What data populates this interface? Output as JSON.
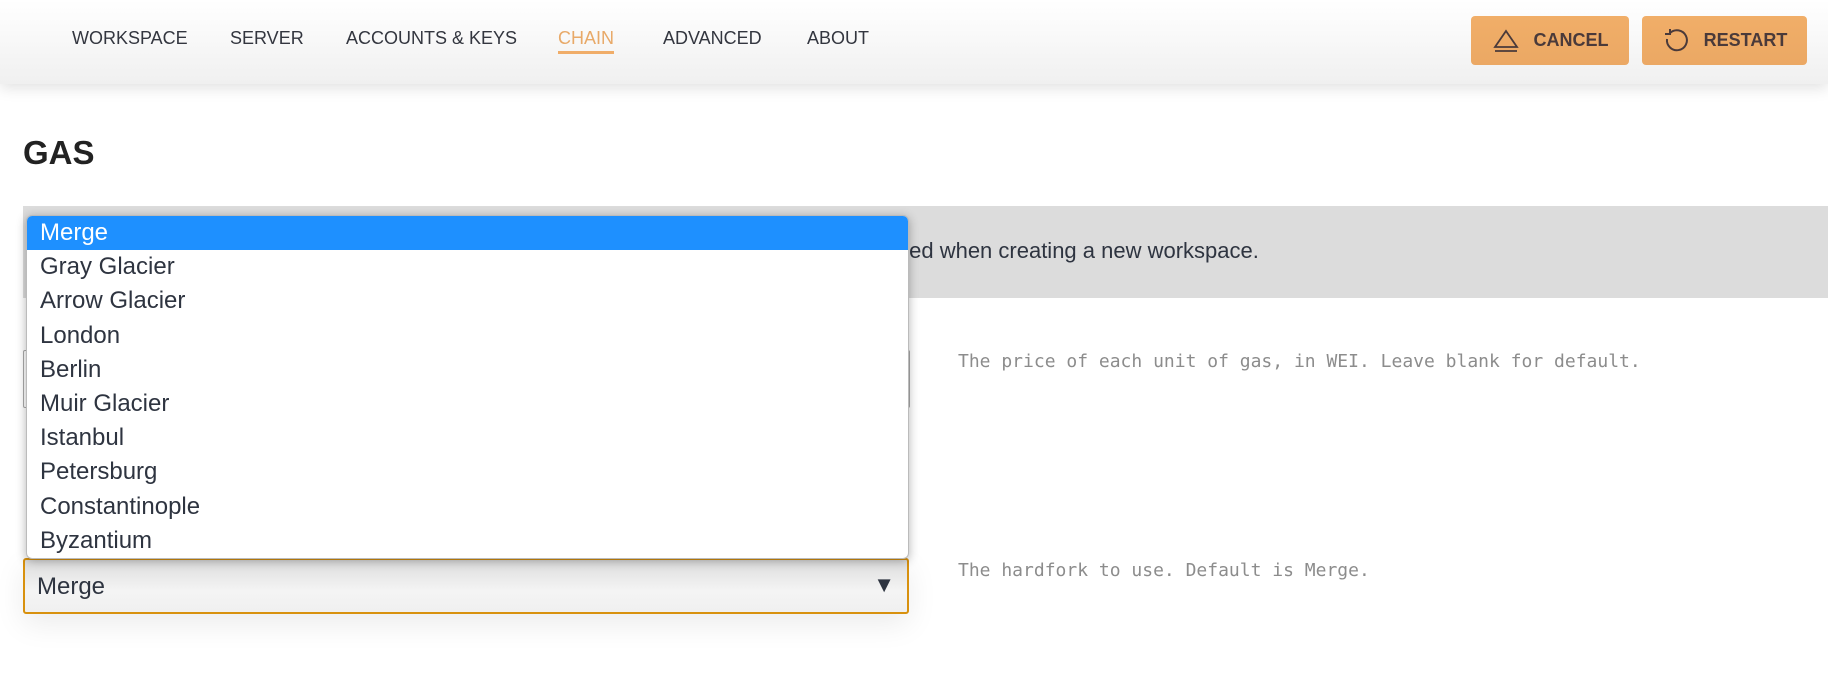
{
  "nav": {
    "items": [
      {
        "label": "WORKSPACE",
        "active": false
      },
      {
        "label": "SERVER",
        "active": false
      },
      {
        "label": "ACCOUNTS & KEYS",
        "active": false
      },
      {
        "label": "CHAIN",
        "active": true
      },
      {
        "label": "ADVANCED",
        "active": false
      },
      {
        "label": "ABOUT",
        "active": false
      }
    ],
    "cancel_label": "CANCEL",
    "cancel_icon": "eject-icon",
    "restart_label": "RESTART",
    "restart_icon": "restart-icon",
    "accent_color": "#f0ad69"
  },
  "section": {
    "title": "GAS",
    "banner_text": "ted when creating a new workspace."
  },
  "gas_price": {
    "description": "The price of each unit of gas, in WEI. Leave blank for default."
  },
  "hardfork": {
    "value": "Merge",
    "description": "The hardfork to use. Default is Merge.",
    "options": [
      "Merge",
      "Gray Glacier",
      "Arrow Glacier",
      "London",
      "Berlin",
      "Muir Glacier",
      "Istanbul",
      "Petersburg",
      "Constantinople",
      "Byzantium"
    ],
    "selected_index": 0,
    "highlight_color": "#1e90ff"
  }
}
